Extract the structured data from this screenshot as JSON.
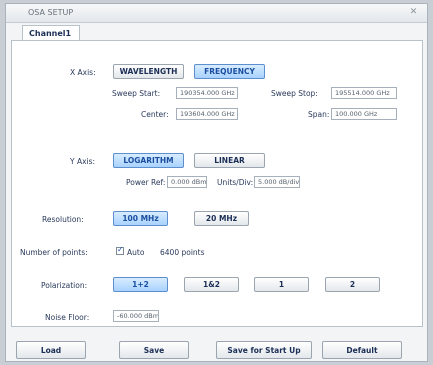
{
  "window": {
    "title": "OSA SETUP"
  },
  "tab": {
    "label": "Channel1"
  },
  "xaxis": {
    "label": "X Axis:",
    "buttons": [
      "WAVELENGTH",
      "FREQUENCY"
    ],
    "selected": "FREQUENCY",
    "sweep_start_label": "Sweep Start:",
    "sweep_start_value": "190354.000 GHz",
    "sweep_stop_label": "Sweep Stop:",
    "sweep_stop_value": "195514.000 GHz",
    "center_label": "Center:",
    "center_value": "193604.000 GHz",
    "span_label": "Span:",
    "span_value": "100.000 GHz"
  },
  "yaxis": {
    "label": "Y Axis:",
    "buttons": [
      "LOGARITHM",
      "LINEAR"
    ],
    "selected": "LOGARITHM",
    "power_ref_label": "Power Ref:",
    "power_ref_value": "0.000 dBm",
    "units_div_label": "Units/Div:",
    "units_div_value": "5.000 dB/div"
  },
  "resolution": {
    "label": "Resolution:",
    "buttons": [
      "100 MHz",
      "20 MHz"
    ],
    "selected": "100 MHz"
  },
  "points": {
    "label": "Number of points:",
    "auto_label": "Auto",
    "auto_checked": true,
    "value": "6400 points"
  },
  "polarization": {
    "label": "Polarization:",
    "buttons": [
      "1+2",
      "1&2",
      "1",
      "2"
    ],
    "selected": "1+2"
  },
  "noise_floor": {
    "label": "Noise Floor:",
    "value": "-60.000 dBm"
  },
  "footer": {
    "load": "Load",
    "save": "Save",
    "save_startup": "Save for Start Up",
    "default": "Default"
  },
  "colors": {
    "selected_button": "#a9d2ff",
    "accent_text": "#1a4fa0"
  }
}
